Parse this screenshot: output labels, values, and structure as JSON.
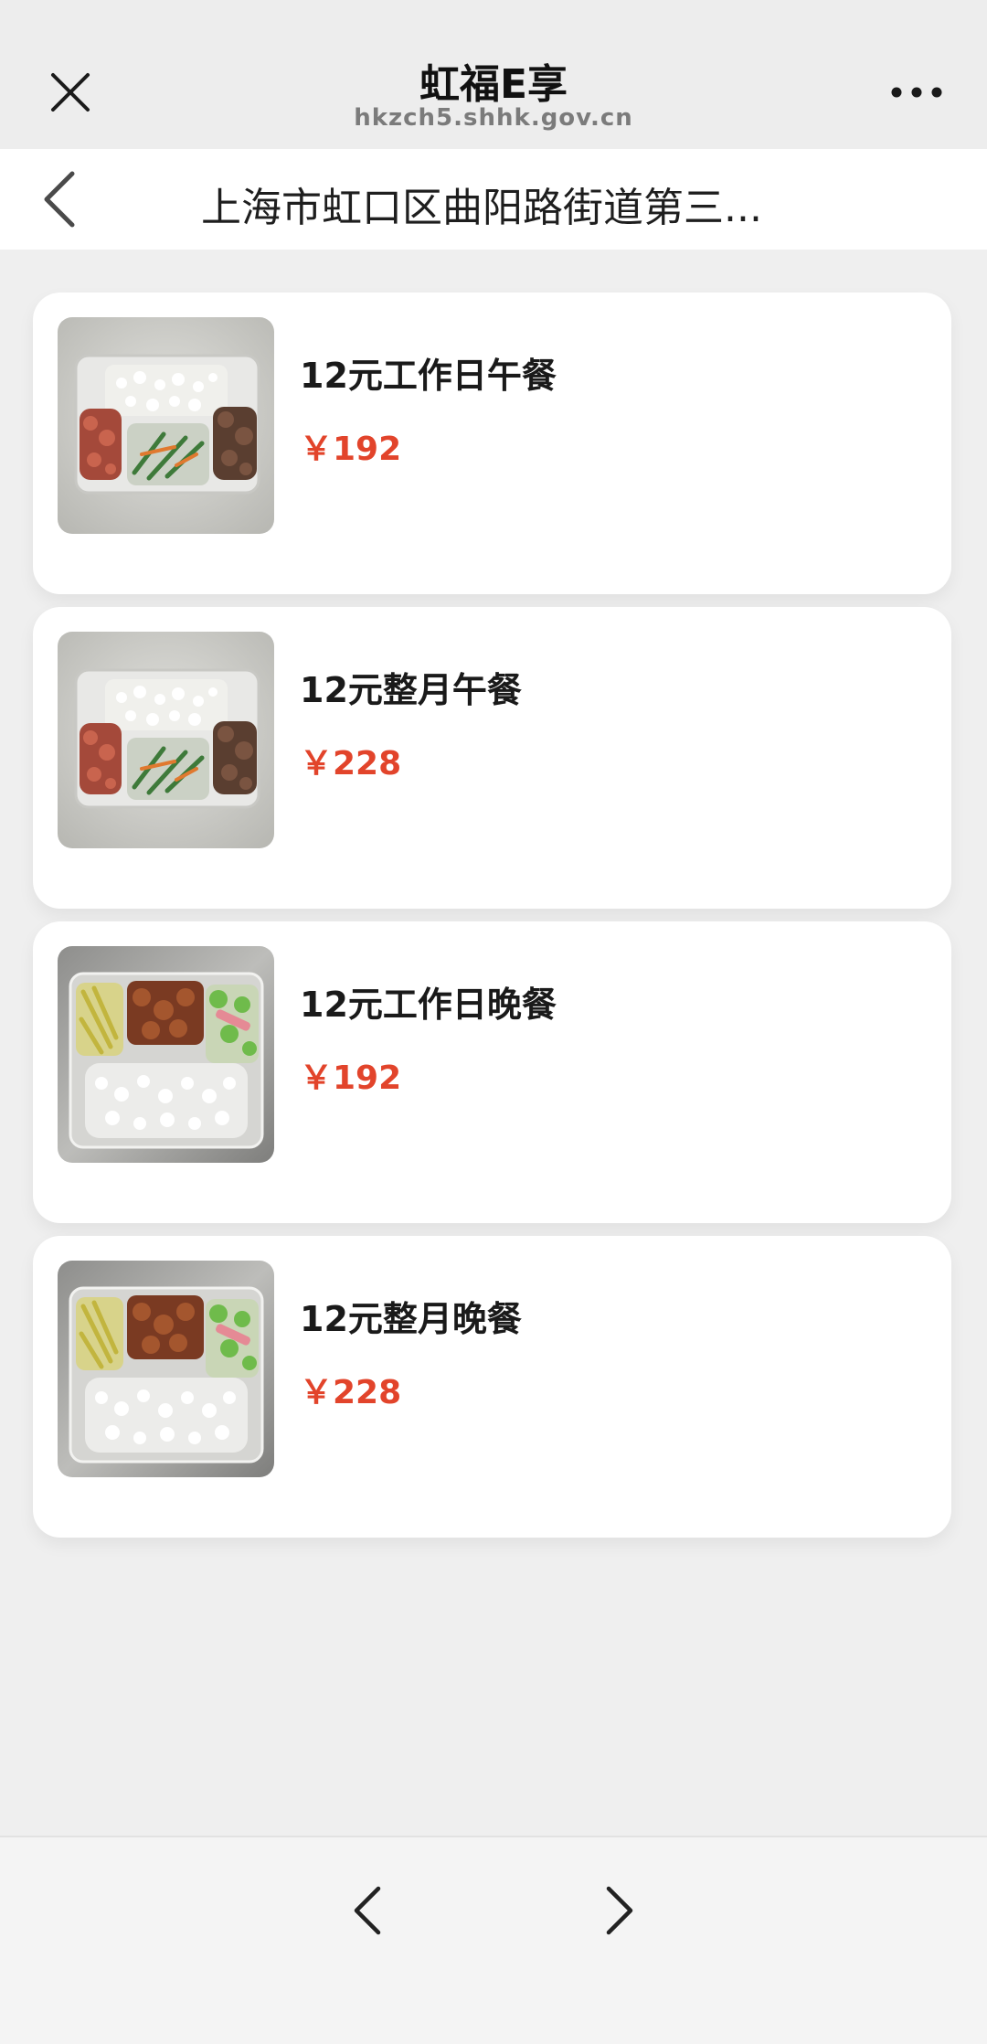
{
  "header": {
    "title": "虹福E享",
    "url": "hkzch5.shhk.gov.cn",
    "close_icon": "close-icon",
    "more_icon": "more-dots-icon"
  },
  "subheader": {
    "title": "上海市虹口区曲阳路街道第三...",
    "back_icon": "chevron-left-icon"
  },
  "products": [
    {
      "name": "12元工作日午餐",
      "price": "￥192",
      "image": "lunch-box-photo"
    },
    {
      "name": "12元整月午餐",
      "price": "￥228",
      "image": "lunch-box-photo"
    },
    {
      "name": "12元工作日晚餐",
      "price": "￥192",
      "image": "dinner-box-photo"
    },
    {
      "name": "12元整月晚餐",
      "price": "￥228",
      "image": "dinner-box-photo"
    }
  ],
  "bottom_nav": {
    "back_icon": "chevron-left-icon",
    "forward_icon": "chevron-right-icon"
  },
  "colors": {
    "price": "#e2442b",
    "header_bg": "#ededed",
    "page_bg": "#efefef"
  }
}
